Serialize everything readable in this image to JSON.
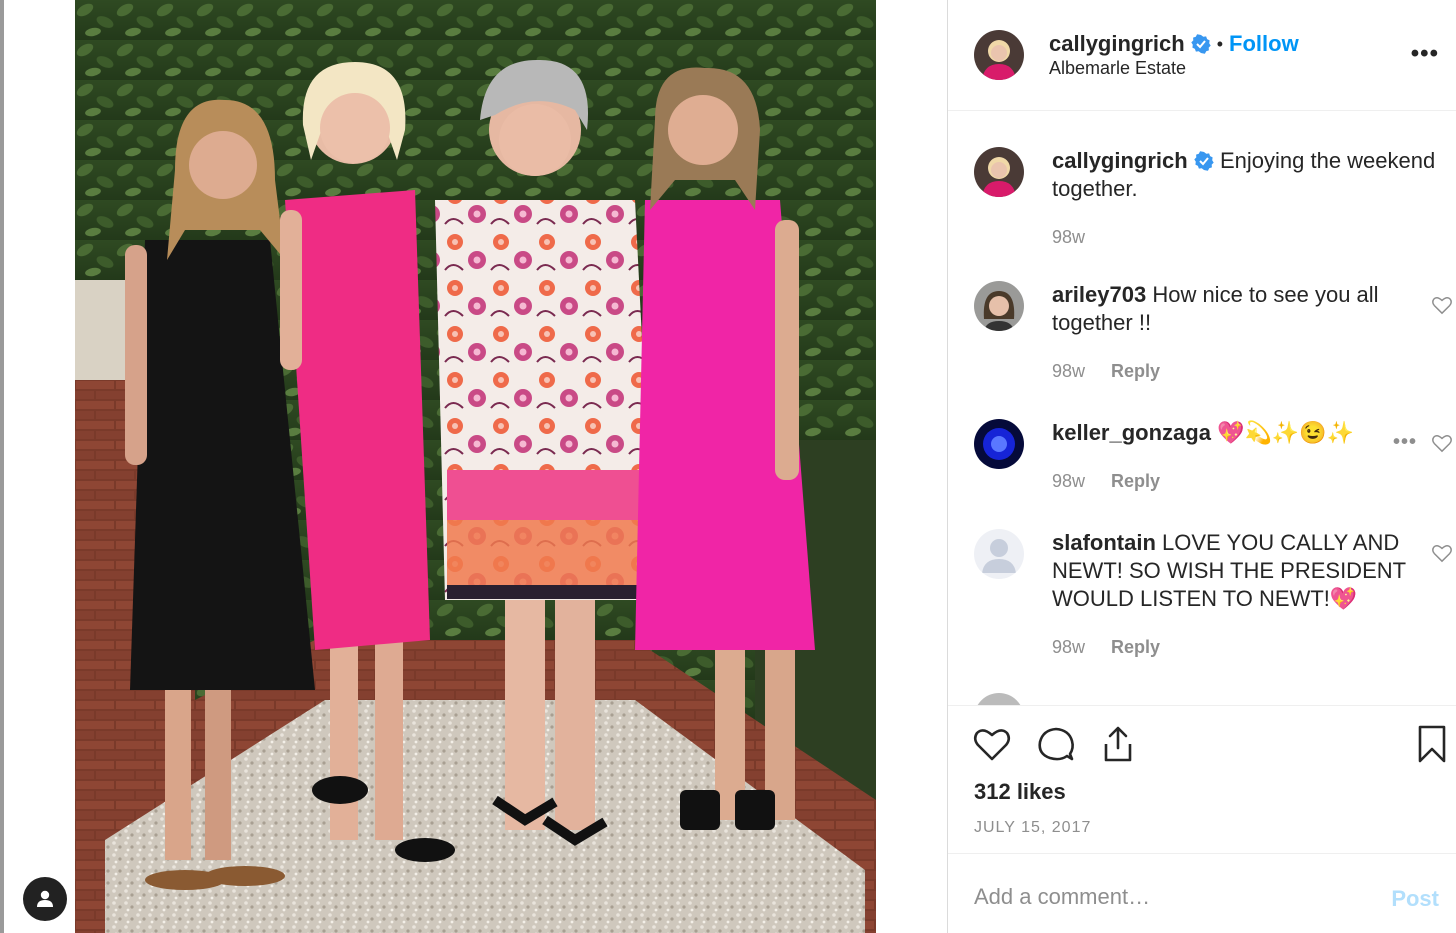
{
  "header": {
    "username": "callygingrich",
    "verified": true,
    "separator": "•",
    "follow_label": "Follow",
    "location": "Albemarle Estate",
    "more_icon": "more-horizontal-icon"
  },
  "caption": {
    "username": "callygingrich",
    "text": "Enjoying the weekend together.",
    "time": "98w"
  },
  "comments": [
    {
      "username": "ariley703",
      "text": "How nice to see you all together !!",
      "time": "98w",
      "reply_label": "Reply"
    },
    {
      "username": "keller_gonzaga",
      "text": "💖💫✨😉✨",
      "time": "98w",
      "reply_label": "Reply"
    },
    {
      "username": "slafontain",
      "text": "LOVE YOU CALLY AND NEWT! SO WISH THE PRESIDENT WOULD LISTEN TO NEWT!💖",
      "time": "98w",
      "reply_label": "Reply"
    }
  ],
  "actions": {
    "like_icon": "heart-icon",
    "comment_icon": "comment-icon",
    "share_icon": "share-icon",
    "save_icon": "bookmark-icon"
  },
  "likes": "312 likes",
  "date": "JULY 15, 2017",
  "add_comment": {
    "placeholder": "Add a comment…",
    "post_label": "Post"
  },
  "colors": {
    "link": "#0095f6",
    "post_disabled": "#b2dffc",
    "muted": "#8e8e8e",
    "text": "#262626"
  }
}
